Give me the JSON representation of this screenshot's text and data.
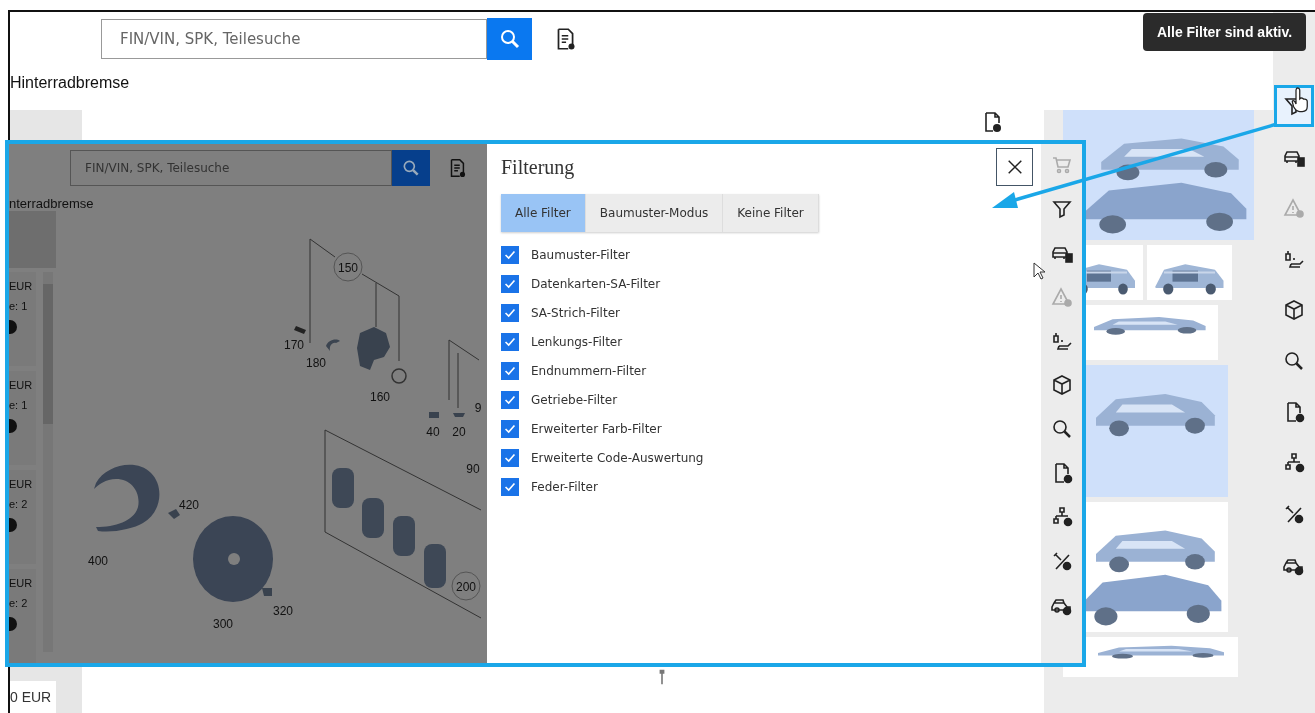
{
  "search": {
    "placeholder": "FIN/VIN, SPK, Teilesuche"
  },
  "breadcrumb": "Hinterradbremse",
  "tooltip": "Alle Filter sind aktiv.",
  "footer_price": "0 EUR",
  "toolbar": [
    {
      "kind": "filter",
      "selected": true,
      "disabled": false
    },
    {
      "kind": "car-doc",
      "selected": false,
      "disabled": false
    },
    {
      "kind": "warning",
      "selected": false,
      "disabled": true
    },
    {
      "kind": "oil",
      "selected": false,
      "disabled": false
    },
    {
      "kind": "box",
      "selected": false,
      "disabled": false
    },
    {
      "kind": "search",
      "selected": false,
      "disabled": false
    },
    {
      "kind": "wis",
      "selected": false,
      "disabled": false
    },
    {
      "kind": "network",
      "selected": false,
      "disabled": false
    },
    {
      "kind": "percent",
      "selected": false,
      "disabled": false
    },
    {
      "kind": "car-wrench",
      "selected": false,
      "disabled": false
    }
  ],
  "inset": {
    "search": {
      "placeholder": "FIN/VIN, SPK, Teilesuche"
    },
    "breadcrumb": "nterradbremse",
    "items": [
      {
        "price": "EUR",
        "quantity": "e: 1"
      },
      {
        "price": "EUR",
        "quantity": "e: 1"
      },
      {
        "price": "EUR",
        "quantity": "e: 2"
      },
      {
        "price": "EUR",
        "quantity": "e: 2"
      }
    ],
    "part_numbers": [
      "150",
      "170",
      "180",
      "160",
      "40",
      "20",
      "9",
      "90",
      "420",
      "400",
      "300",
      "320",
      "200"
    ],
    "dialog": {
      "title": "Filterung",
      "modes": [
        {
          "label": "Alle Filter",
          "selected": true
        },
        {
          "label": "Baumuster-Modus",
          "selected": false
        },
        {
          "label": "Keine Filter",
          "selected": false
        }
      ],
      "filters": [
        {
          "label": "Baumuster-Filter",
          "checked": true
        },
        {
          "label": "Datenkarten-SA-Filter",
          "checked": true
        },
        {
          "label": "SA-Strich-Filter",
          "checked": true
        },
        {
          "label": "Lenkungs-Filter",
          "checked": true
        },
        {
          "label": "Endnummern-Filter",
          "checked": true
        },
        {
          "label": "Getriebe-Filter",
          "checked": true
        },
        {
          "label": "Erweiterter Farb-Filter",
          "checked": true
        },
        {
          "label": "Erweiterte Code-Auswertung",
          "checked": true
        },
        {
          "label": "Feder-Filter",
          "checked": true
        }
      ]
    },
    "toolbar": [
      {
        "kind": "cart",
        "disabled": true
      },
      {
        "kind": "filter",
        "disabled": false
      },
      {
        "kind": "car-doc",
        "disabled": false
      },
      {
        "kind": "warning",
        "disabled": true
      },
      {
        "kind": "oil",
        "disabled": false
      },
      {
        "kind": "box",
        "disabled": false
      },
      {
        "kind": "search",
        "disabled": false
      },
      {
        "kind": "wis",
        "disabled": false
      },
      {
        "kind": "network",
        "disabled": false
      },
      {
        "kind": "percent",
        "disabled": false
      },
      {
        "kind": "car-wrench",
        "disabled": false
      }
    ]
  }
}
